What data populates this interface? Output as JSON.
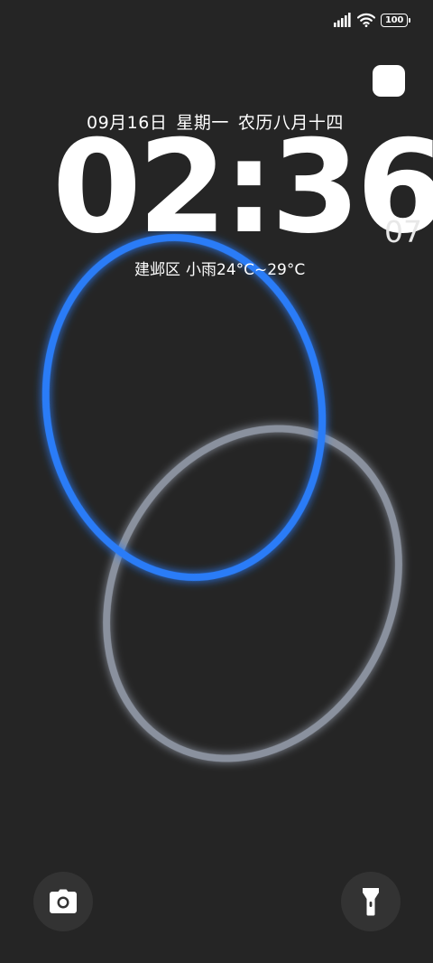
{
  "status_bar": {
    "signal_icon": "signal-icon",
    "wifi_icon": "wifi-icon",
    "battery_level": "100"
  },
  "lockscreen": {
    "date": "09月16日",
    "weekday": "星期一",
    "lunar_date": "农历八月十四",
    "time": "02:36",
    "seconds": "07",
    "location": "建邺区",
    "weather": "小雨24°C~29°C"
  },
  "shortcuts": {
    "left_icon": "camera-icon",
    "right_icon": "flashlight-icon"
  },
  "colors": {
    "background": "#252525",
    "ring_blue": "#2a7cf7",
    "ring_gray": "#8a919e",
    "button_bg": "#333333"
  }
}
